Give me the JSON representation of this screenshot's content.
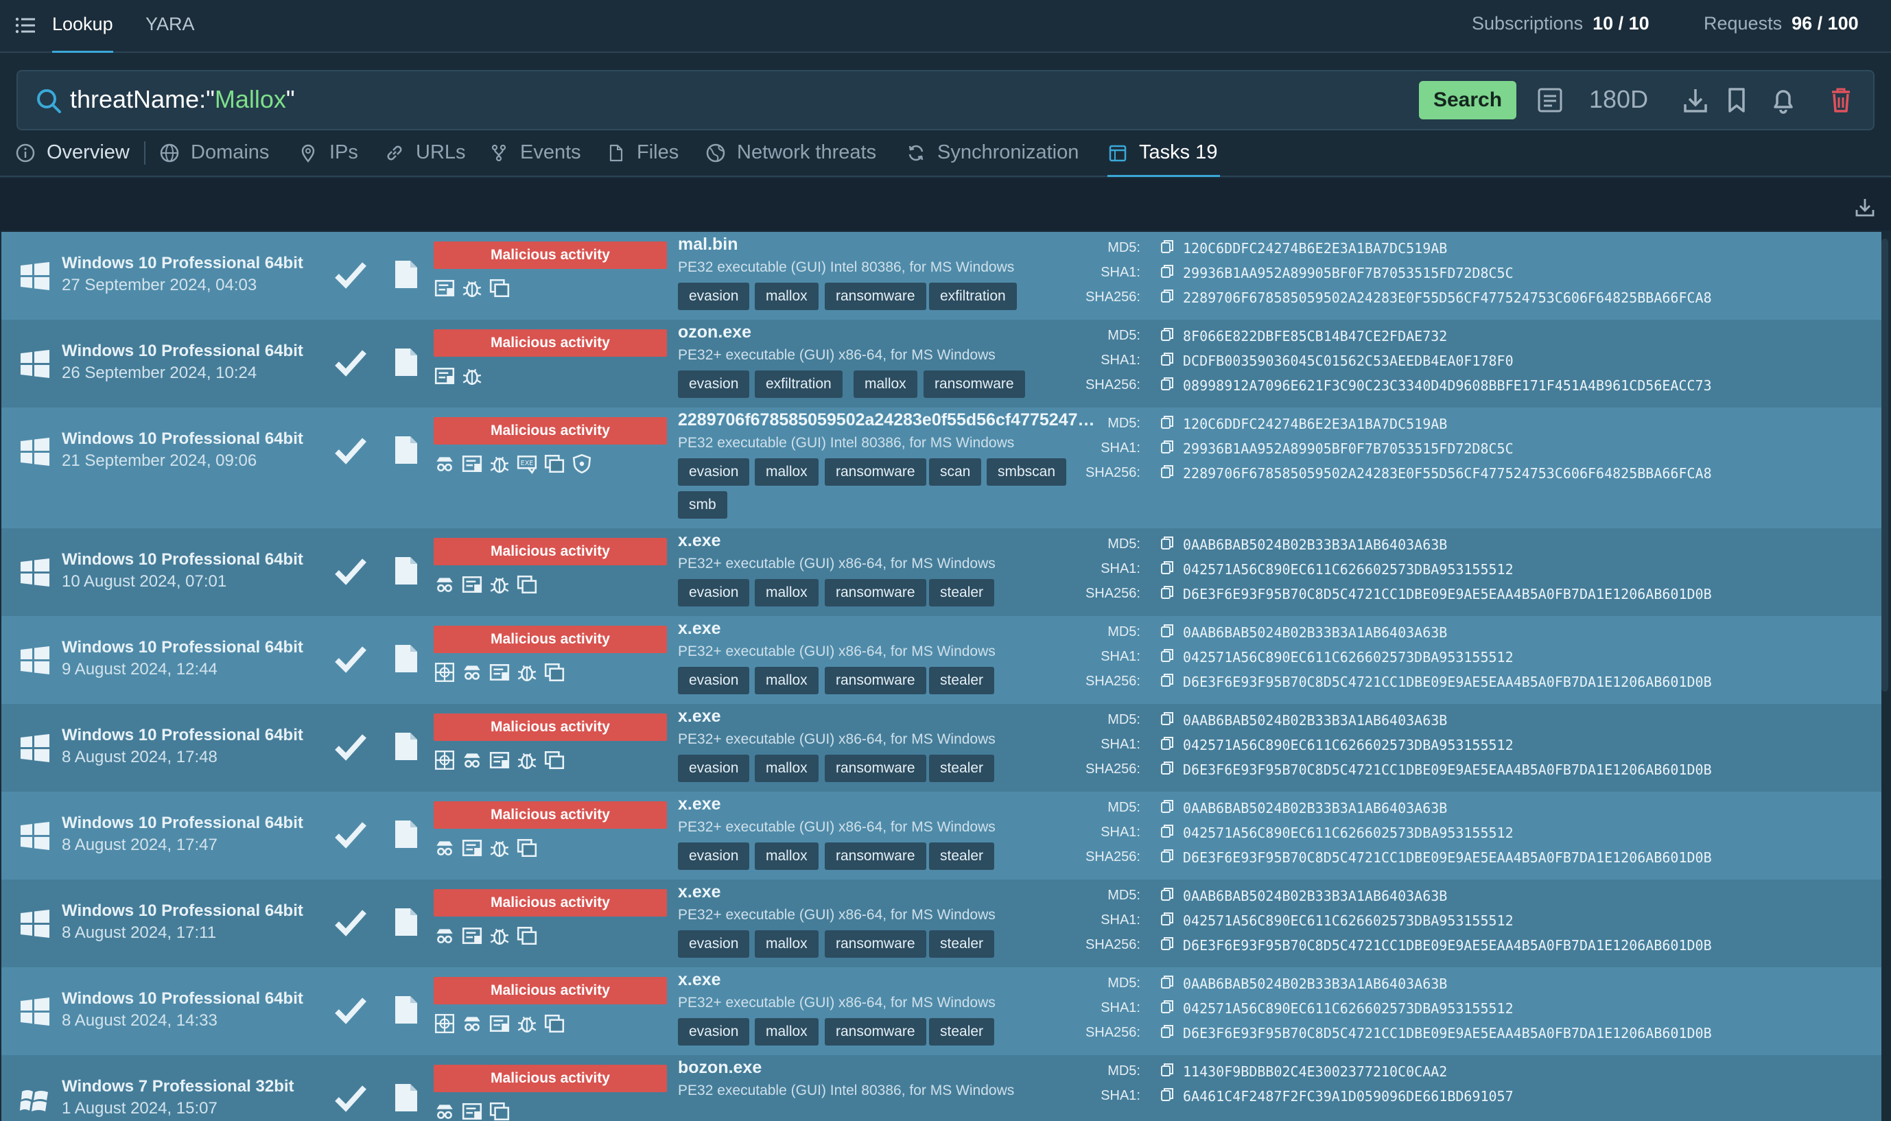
{
  "topbar": {
    "tabs": [
      "Lookup",
      "YARA"
    ],
    "subscriptions_label": "Subscriptions",
    "subscriptions_value": "10 / 10",
    "requests_label": "Requests",
    "requests_value": "96 / 100"
  },
  "search": {
    "query_prefix": "threatName:\"",
    "query_value": "Mallox",
    "query_suffix": "\"",
    "button": "Search",
    "period": "180D"
  },
  "subtabs": [
    "Overview",
    "Domains",
    "IPs",
    "URLs",
    "Events",
    "Files",
    "Network threats",
    "Synchronization",
    "Tasks 19"
  ],
  "hash_labels": [
    "MD5:",
    "SHA1:",
    "SHA256:"
  ],
  "tasks": [
    {
      "os": "Windows 10 Professional 64bit",
      "date": "27 September 2024, 04:03",
      "verdict": "Malicious activity",
      "name": "mal.bin",
      "type": "PE32 executable (GUI) Intel 80386, for MS Windows",
      "tags": [
        "evasion",
        "mallox",
        "ransomware",
        "exfiltration"
      ],
      "md5": "120C6DDFC24274B6E2E3A1BA7DC519AB",
      "sha1": "29936B1AA952A89905BF0F7B7053515FD72D8C5C",
      "sha256": "2289706F678585059502A24283E0F55D56CF477524753C606F64825BBA66FCA8"
    },
    {
      "os": "Windows 10 Professional 64bit",
      "date": "26 September 2024, 10:24",
      "verdict": "Malicious activity",
      "name": "ozon.exe",
      "type": "PE32+ executable (GUI) x86-64, for MS Windows",
      "tags": [
        "evasion",
        "exfiltration",
        "mallox",
        "ransomware"
      ],
      "md5": "8F066E822DBFE85CB14B47CE2FDAE732",
      "sha1": "DCDFB00359036045C01562C53AEEDB4EA0F178F0",
      "sha256": "08998912A7096E621F3C90C23C3340D4D9608BBFE171F451A4B961CD56EACC73"
    },
    {
      "os": "Windows 10 Professional 64bit",
      "date": "21 September 2024, 09:06",
      "verdict": "Malicious activity",
      "name": "2289706f678585059502a24283e0f55d56cf4775247…",
      "type": "PE32 executable (GUI) Intel 80386, for MS Windows",
      "tags": [
        "evasion",
        "mallox",
        "ransomware",
        "scan",
        "smbscan",
        "smb"
      ],
      "md5": "120C6DDFC24274B6E2E3A1BA7DC519AB",
      "sha1": "29936B1AA952A89905BF0F7B7053515FD72D8C5C",
      "sha256": "2289706F678585059502A24283E0F55D56CF477524753C606F64825BBA66FCA8"
    },
    {
      "os": "Windows 10 Professional 64bit",
      "date": "10 August 2024, 07:01",
      "verdict": "Malicious activity",
      "name": "x.exe",
      "type": "PE32+ executable (GUI) x86-64, for MS Windows",
      "tags": [
        "evasion",
        "mallox",
        "ransomware",
        "stealer"
      ],
      "md5": "0AAB6BAB5024B02B33B3A1AB6403A63B",
      "sha1": "042571A56C890EC611C626602573DBA953155512",
      "sha256": "D6E3F6E93F95B70C8D5C4721CC1DBE09E9AE5EAA4B5A0FB7DA1E1206AB601D0B"
    },
    {
      "os": "Windows 10 Professional 64bit",
      "date": "9 August 2024, 12:44",
      "verdict": "Malicious activity",
      "name": "x.exe",
      "type": "PE32+ executable (GUI) x86-64, for MS Windows",
      "tags": [
        "evasion",
        "mallox",
        "ransomware",
        "stealer"
      ],
      "md5": "0AAB6BAB5024B02B33B3A1AB6403A63B",
      "sha1": "042571A56C890EC611C626602573DBA953155512",
      "sha256": "D6E3F6E93F95B70C8D5C4721CC1DBE09E9AE5EAA4B5A0FB7DA1E1206AB601D0B"
    },
    {
      "os": "Windows 10 Professional 64bit",
      "date": "8 August 2024, 17:48",
      "verdict": "Malicious activity",
      "name": "x.exe",
      "type": "PE32+ executable (GUI) x86-64, for MS Windows",
      "tags": [
        "evasion",
        "mallox",
        "ransomware",
        "stealer"
      ],
      "md5": "0AAB6BAB5024B02B33B3A1AB6403A63B",
      "sha1": "042571A56C890EC611C626602573DBA953155512",
      "sha256": "D6E3F6E93F95B70C8D5C4721CC1DBE09E9AE5EAA4B5A0FB7DA1E1206AB601D0B"
    },
    {
      "os": "Windows 10 Professional 64bit",
      "date": "8 August 2024, 17:47",
      "verdict": "Malicious activity",
      "name": "x.exe",
      "type": "PE32+ executable (GUI) x86-64, for MS Windows",
      "tags": [
        "evasion",
        "mallox",
        "ransomware",
        "stealer"
      ],
      "md5": "0AAB6BAB5024B02B33B3A1AB6403A63B",
      "sha1": "042571A56C890EC611C626602573DBA953155512",
      "sha256": "D6E3F6E93F95B70C8D5C4721CC1DBE09E9AE5EAA4B5A0FB7DA1E1206AB601D0B"
    },
    {
      "os": "Windows 10 Professional 64bit",
      "date": "8 August 2024, 17:11",
      "verdict": "Malicious activity",
      "name": "x.exe",
      "type": "PE32+ executable (GUI) x86-64, for MS Windows",
      "tags": [
        "evasion",
        "mallox",
        "ransomware",
        "stealer"
      ],
      "md5": "0AAB6BAB5024B02B33B3A1AB6403A63B",
      "sha1": "042571A56C890EC611C626602573DBA953155512",
      "sha256": "D6E3F6E93F95B70C8D5C4721CC1DBE09E9AE5EAA4B5A0FB7DA1E1206AB601D0B"
    },
    {
      "os": "Windows 10 Professional 64bit",
      "date": "8 August 2024, 14:33",
      "verdict": "Malicious activity",
      "name": "x.exe",
      "type": "PE32+ executable (GUI) x86-64, for MS Windows",
      "tags": [
        "evasion",
        "mallox",
        "ransomware",
        "stealer"
      ],
      "md5": "0AAB6BAB5024B02B33B3A1AB6403A63B",
      "sha1": "042571A56C890EC611C626602573DBA953155512",
      "sha256": "D6E3F6E93F95B70C8D5C4721CC1DBE09E9AE5EAA4B5A0FB7DA1E1206AB601D0B"
    },
    {
      "os": "Windows 7 Professional 32bit",
      "date": "1 August 2024, 15:07",
      "verdict": "Malicious activity",
      "name": "bozon.exe",
      "type": "PE32 executable (GUI) Intel 80386, for MS Windows",
      "tags": [],
      "md5": "11430F9BDBB02C4E3002377210C0CAA2",
      "sha1": "6A461C4F2487F2FC39A1D059096DE661BD691057",
      "sha256": ""
    }
  ],
  "colors": {
    "verdict_bg": "#d9534f",
    "accent": "#3aa9d8",
    "search_button": "#7ed58d"
  }
}
